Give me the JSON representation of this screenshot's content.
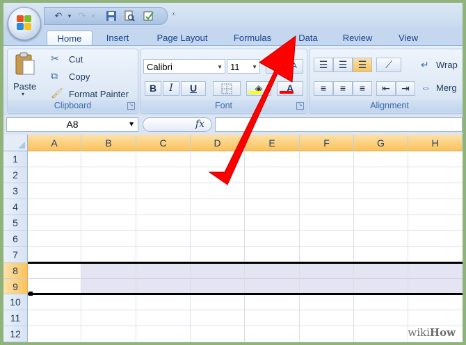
{
  "quick_access": {
    "icons": [
      "undo-icon",
      "redo-icon",
      "save-icon",
      "print-preview-icon",
      "spelling-icon"
    ]
  },
  "tabs": [
    "Home",
    "Insert",
    "Page Layout",
    "Formulas",
    "Data",
    "Review",
    "View"
  ],
  "active_tab": "Home",
  "clipboard": {
    "paste": "Paste",
    "cut": "Cut",
    "copy": "Copy",
    "format_painter": "Format Painter",
    "label": "Clipboard"
  },
  "font": {
    "name": "Calibri",
    "size": "11",
    "bold": "B",
    "italic": "I",
    "underline": "U",
    "label": "Font"
  },
  "alignment": {
    "wrap": "Wrap",
    "merge": "Merg",
    "label": "Alignment"
  },
  "formula_bar": {
    "name_box": "A8",
    "fx": "fx",
    "value": ""
  },
  "grid": {
    "columns": [
      "A",
      "B",
      "C",
      "D",
      "E",
      "F",
      "G",
      "H"
    ],
    "rows": [
      "1",
      "2",
      "3",
      "4",
      "5",
      "6",
      "7",
      "8",
      "9",
      "10",
      "11",
      "12"
    ],
    "selected_rows": [
      "8",
      "9"
    ],
    "active_cell": "A8"
  },
  "colors": {
    "tab_text": "#15428b",
    "header_selected": "#f9c25c",
    "arrow": "#ff0000",
    "selection": "#e4e4f2"
  },
  "watermark": {
    "prefix": "wiki",
    "suffix": "How"
  }
}
